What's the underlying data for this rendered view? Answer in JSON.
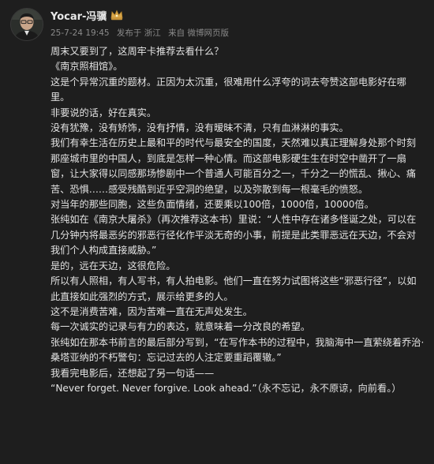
{
  "user": {
    "name": "Yocar-冯骥"
  },
  "meta": {
    "time": "25-7-24 19:45",
    "location": "发布于 浙江",
    "source": "来自 微博网页版"
  },
  "icons": {
    "avatar": "avatar-photo",
    "badge": "vip-crown-icon"
  },
  "post": {
    "paragraphs": [
      "周末又要到了，这周牢卡推荐去看什么？",
      "《南京照相馆》。",
      "这是个异常沉重的题材。正因为太沉重，很难用什么浮夸的词去夸赞这部电影好在哪里。",
      "非要说的话，好在真实。",
      "没有犹豫，没有矫饰，没有抒情，没有暧昧不清，只有血淋淋的事实。",
      "我们有幸生活在历史上最和平的时代与最安全的国度，天然难以真正理解身处那个时刻那座城市里的中国人，到底是怎样一种心情。而这部电影硬生生在时空中凿开了一扇窗，让大家得以同感那场惨剧中一个普通人可能百分之一，千分之一的慌乱、揪心、痛苦、恐惧……感受残酷到近乎空洞的绝望，以及弥散到每一根毫毛的愤怒。",
      "对当年的那些同胞，这些负面情绪，还要乘以100倍，1000倍，10000倍。",
      "张纯如在《南京大屠杀》（再次推荐这本书）里说：“人性中存在诸多怪诞之处，可以在几分钟内将最恶劣的邪恶行径化作平淡无奇的小事，前提是此类罪恶远在天边，不会对我们个人构成直接威胁。”",
      "是的，远在天边，这很危险。",
      "所以有人照相，有人写书，有人拍电影。他们一直在努力试图将这些“邪恶行径”，以如此直接如此强烈的方式，展示给更多的人。",
      "这不是消费苦难，因为苦难一直在无声处发生。",
      "每一次诚实的记录与有力的表达，就意味着一分改良的希望。",
      "张纯如在那本书前言的最后部分写到，“在写作本书的过程中，我脑海中一直萦绕着乔治·桑塔亚纳的不朽警句：忘记过去的人注定要重蹈覆辙。”",
      "我看完电影后，还想起了另一句话——",
      "“Never forget. Never forgive. Look ahead.”（永不忘记，永不原谅，向前看。）"
    ]
  }
}
